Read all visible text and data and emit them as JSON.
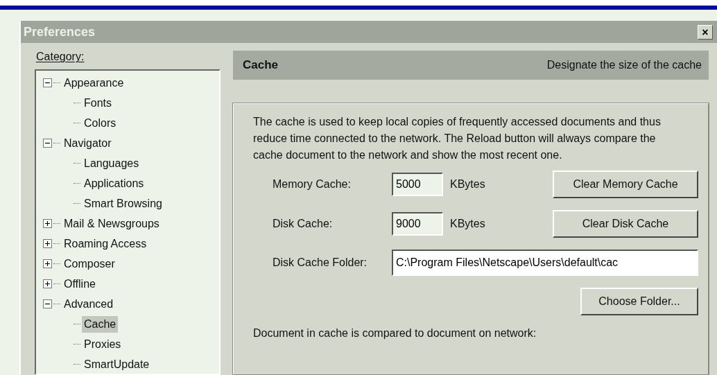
{
  "window": {
    "title": "Preferences",
    "close": "×"
  },
  "category": {
    "label": "Category:",
    "tree": [
      {
        "label": "Appearance",
        "expanded": true,
        "selected": false,
        "children": [
          {
            "label": "Fonts",
            "selected": false
          },
          {
            "label": "Colors",
            "selected": false
          }
        ]
      },
      {
        "label": "Navigator",
        "expanded": true,
        "selected": false,
        "children": [
          {
            "label": "Languages",
            "selected": false
          },
          {
            "label": "Applications",
            "selected": false
          },
          {
            "label": "Smart Browsing",
            "selected": false
          }
        ]
      },
      {
        "label": "Mail & Newsgroups",
        "expanded": false,
        "selected": false
      },
      {
        "label": "Roaming Access",
        "expanded": false,
        "selected": false
      },
      {
        "label": "Composer",
        "expanded": false,
        "selected": false
      },
      {
        "label": "Offline",
        "expanded": false,
        "selected": false
      },
      {
        "label": "Advanced",
        "expanded": true,
        "selected": false,
        "children": [
          {
            "label": "Cache",
            "selected": true
          },
          {
            "label": "Proxies",
            "selected": false
          },
          {
            "label": "SmartUpdate",
            "selected": false
          }
        ]
      }
    ]
  },
  "panel": {
    "title": "Cache",
    "subtitle": "Designate the size of the cache",
    "description": "The cache is used to keep local copies of frequently accessed documents and thus reduce time connected to the network. The Reload button will always compare the cache document to the network and show the most recent one.",
    "memory_cache": {
      "label": "Memory Cache:",
      "value": "5000",
      "unit": "KBytes",
      "button": "Clear Memory Cache"
    },
    "disk_cache": {
      "label": "Disk Cache:",
      "value": "9000",
      "unit": "KBytes",
      "button": "Clear Disk Cache"
    },
    "folder": {
      "label": "Disk Cache Folder:",
      "value": "C:\\Program Files\\Netscape\\Users\\default\\cac",
      "button": "Choose Folder..."
    },
    "compare_text": "Document in cache is compared to document on network:"
  }
}
